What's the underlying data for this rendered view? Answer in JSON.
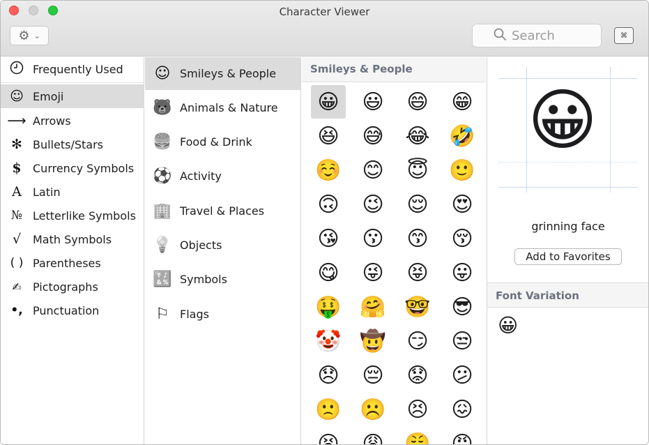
{
  "window": {
    "title": "Character Viewer"
  },
  "toolbar": {
    "gear_icon": "⚙",
    "chevron": "⌄",
    "search_placeholder": "Search",
    "search_value": "",
    "keyboard_glyph": "⌘"
  },
  "categories": [
    {
      "label": "Frequently Used",
      "icon": "🕘"
    },
    {
      "label": "Emoji",
      "icon": "☺"
    },
    {
      "label": "Arrows",
      "icon": "⟶"
    },
    {
      "label": "Bullets/Stars",
      "icon": "✻"
    },
    {
      "label": "Currency Symbols",
      "icon": "$"
    },
    {
      "label": "Latin",
      "icon": "A"
    },
    {
      "label": "Letterlike Symbols",
      "icon": "№"
    },
    {
      "label": "Math Symbols",
      "icon": "√"
    },
    {
      "label": "Parentheses",
      "icon": "( )"
    },
    {
      "label": "Pictographs",
      "icon": "✍"
    },
    {
      "label": "Punctuation",
      "icon": "•,"
    }
  ],
  "subcategories": [
    {
      "label": "Smileys & People",
      "icon": "☺"
    },
    {
      "label": "Animals & Nature",
      "icon": "🐻"
    },
    {
      "label": "Food & Drink",
      "icon": "🍔"
    },
    {
      "label": "Activity",
      "icon": "⚽"
    },
    {
      "label": "Travel & Places",
      "icon": "🏢"
    },
    {
      "label": "Objects",
      "icon": "💡"
    },
    {
      "label": "Symbols",
      "icon": "🔣"
    },
    {
      "label": "Flags",
      "icon": "⚐"
    }
  ],
  "grid": {
    "header": "Smileys & People",
    "emojis": [
      "😀",
      "😃",
      "😄",
      "😁",
      "😆",
      "😅",
      "😂",
      "🤣",
      "☺️",
      "😊",
      "😇",
      "🙂",
      "🙃",
      "😉",
      "😌",
      "😍",
      "😘",
      "😗",
      "😙",
      "😚",
      "😋",
      "😜",
      "😝",
      "😛",
      "🤑",
      "🤗",
      "🤓",
      "😎",
      "🤡",
      "🤠",
      "😏",
      "😒",
      "😞",
      "😔",
      "😟",
      "😕",
      "🙁",
      "☹️",
      "😣",
      "😖",
      "😫",
      "😩",
      "😤",
      "😠"
    ]
  },
  "detail": {
    "preview_emoji": "😀",
    "name": "grinning face",
    "add_favorites_label": "Add to Favorites",
    "font_variation_header": "Font Variation",
    "variation_emoji": "😀"
  }
}
